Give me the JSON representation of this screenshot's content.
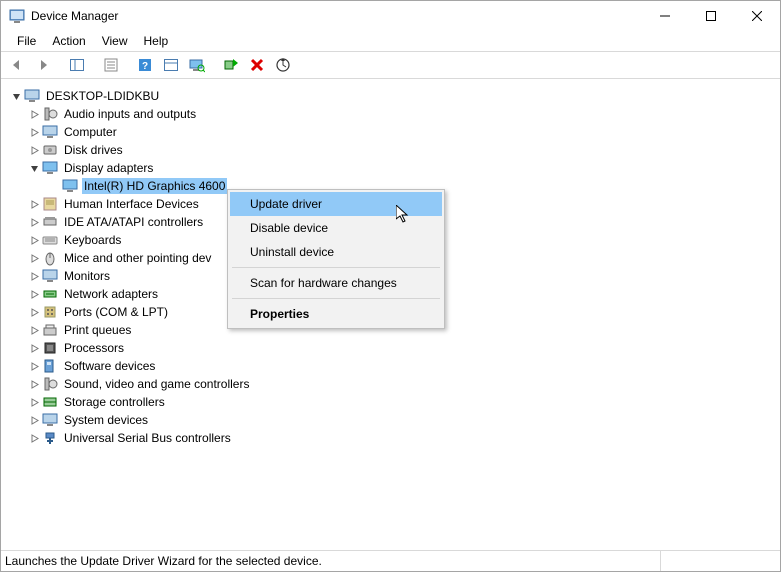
{
  "window": {
    "title": "Device Manager"
  },
  "menu": {
    "file": "File",
    "action": "Action",
    "view": "View",
    "help": "Help"
  },
  "tree": {
    "root": "DESKTOP-LDIDKBU",
    "items": [
      {
        "label": "Audio inputs and outputs",
        "expanded": false
      },
      {
        "label": "Computer",
        "expanded": false
      },
      {
        "label": "Disk drives",
        "expanded": false
      },
      {
        "label": "Display adapters",
        "expanded": true,
        "children": [
          {
            "label": "Intel(R) HD Graphics 4600",
            "selected": true
          }
        ]
      },
      {
        "label": "Human Interface Devices",
        "expanded": false
      },
      {
        "label": "IDE ATA/ATAPI controllers",
        "expanded": false
      },
      {
        "label": "Keyboards",
        "expanded": false
      },
      {
        "label": "Mice and other pointing dev",
        "expanded": false
      },
      {
        "label": "Monitors",
        "expanded": false
      },
      {
        "label": "Network adapters",
        "expanded": false
      },
      {
        "label": "Ports (COM & LPT)",
        "expanded": false
      },
      {
        "label": "Print queues",
        "expanded": false
      },
      {
        "label": "Processors",
        "expanded": false
      },
      {
        "label": "Software devices",
        "expanded": false
      },
      {
        "label": "Sound, video and game controllers",
        "expanded": false
      },
      {
        "label": "Storage controllers",
        "expanded": false
      },
      {
        "label": "System devices",
        "expanded": false
      },
      {
        "label": "Universal Serial Bus controllers",
        "expanded": false
      }
    ]
  },
  "context_menu": {
    "update": "Update driver",
    "disable": "Disable device",
    "uninstall": "Uninstall device",
    "scan": "Scan for hardware changes",
    "properties": "Properties"
  },
  "status": "Launches the Update Driver Wizard for the selected device."
}
